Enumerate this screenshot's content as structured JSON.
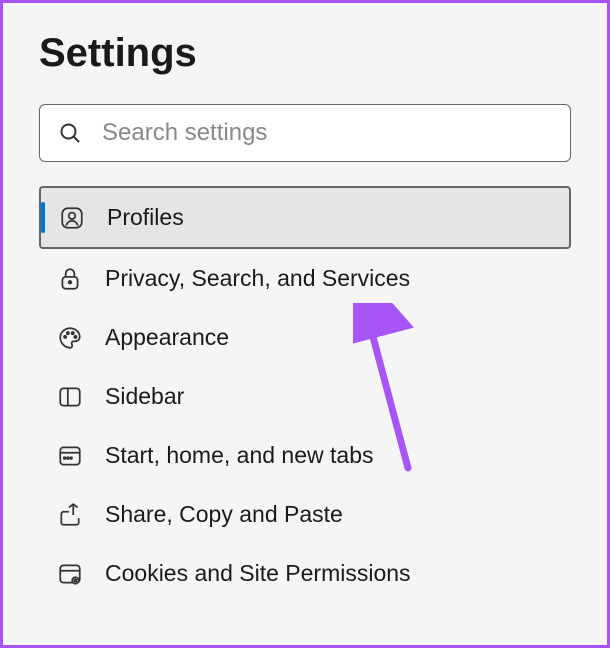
{
  "header": {
    "title": "Settings"
  },
  "search": {
    "placeholder": "Search settings"
  },
  "nav": {
    "items": [
      {
        "id": "profiles",
        "label": "Profiles",
        "selected": true
      },
      {
        "id": "privacy",
        "label": "Privacy, Search, and Services",
        "selected": false
      },
      {
        "id": "appearance",
        "label": "Appearance",
        "selected": false
      },
      {
        "id": "sidebar",
        "label": "Sidebar",
        "selected": false
      },
      {
        "id": "start",
        "label": "Start, home, and new tabs",
        "selected": false
      },
      {
        "id": "share",
        "label": "Share, Copy and Paste",
        "selected": false
      },
      {
        "id": "cookies",
        "label": "Cookies and Site Permissions",
        "selected": false
      }
    ]
  },
  "annotation": {
    "cursor_color": "#a855f7"
  }
}
